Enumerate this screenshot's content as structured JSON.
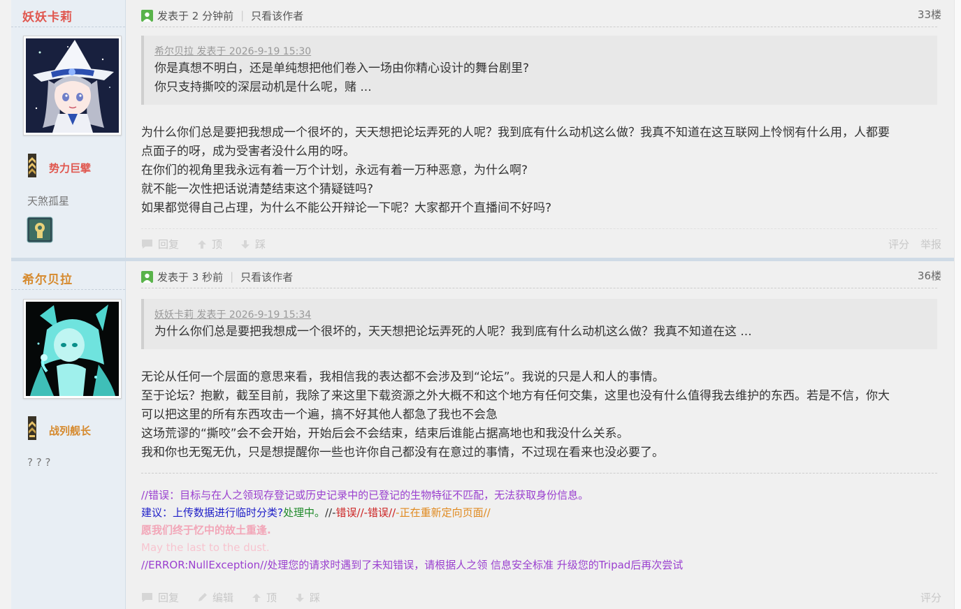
{
  "posts": [
    {
      "author": "妖妖卡莉",
      "author_color": "#e0564e",
      "rank": "势力巨擘",
      "rank_color": "#e0564e",
      "user_title": "天煞孤星",
      "posted": "发表于 2 分钟前",
      "only_author": "只看该作者",
      "floor": "33楼",
      "quote": {
        "head": "希尔贝拉 发表于 2026-9-19 15:30",
        "lines": [
          "你是真想不明白，还是单纯想把他们卷入一场由你精心设计的舞台剧里?",
          "你只支持撕咬的深层动机是什么呢，赌 ..."
        ]
      },
      "body": [
        "为什么你们总是要把我想成一个很坏的，天天想把论坛弄死的人呢？我到底有什么动机这么做？我真不知道在这互联网上怜悯有什么用，人都要",
        "点面子的呀，成为受害者没什么用的呀。",
        "在你们的视角里我永远有着一万个计划，永远有着一万种恶意，为什么啊?",
        "就不能一次性把话说清楚结束这个猜疑链吗?",
        "如果都觉得自己占理，为什么不能公开辩论一下呢？大家都开个直播间不好吗?"
      ],
      "actions": {
        "reply": "回复",
        "top": "顶",
        "down": "踩"
      },
      "actions_right": [
        "评分",
        "举报"
      ]
    },
    {
      "author": "希尔贝拉",
      "author_color": "#d68a2e",
      "rank": "战列舰长",
      "rank_color": "#d68a2e",
      "user_title": "? ? ?",
      "posted": "发表于 3 秒前",
      "only_author": "只看该作者",
      "floor": "36楼",
      "quote": {
        "head": "妖妖卡莉 发表于 2026-9-19 15:34",
        "lines": [
          "为什么你们总是要把我想成一个很坏的，天天想把论坛弄死的人呢？我到底有什么动机这么做？我真不知道在这 ..."
        ]
      },
      "body": [
        "无论从任何一个层面的意思来看，我相信我的表达都不会涉及到“论坛”。我说的只是人和人的事情。",
        "至于论坛？抱歉，截至目前，我除了来这里下载资源之外大概不和这个地方有任何交集，这里也没有什么值得我去维护的东西。若是不信，你大",
        "可以把这里的所有东西攻击一个遍，搞不好其他人都急了我也不会急",
        "这场荒谬的“撕咬”会不会开始，开始后会不会结束，结束后谁能占据高地也和我没什么关系。",
        "我和你也无冤无仇，只是想提醒你一些也许你自己都没有在意过的事情，不过现在看来也没必要了。"
      ],
      "signature": {
        "line1": "//错误：目标与在人之领现存登记或历史记录中的已登记的生物特征不匹配，无法获取身份信息。",
        "line2_a": "建议：上传数据进行临时分类?",
        "line2_b": "处理中。",
        "line2_c": "//-",
        "line2_d": "错误//-",
        "line2_e": "错误//",
        "line2_f": "-正在重新定向页面//",
        "line3": "愿我们终于忆中的故土重逢.",
        "line4": "May the last to the dust.",
        "line5": "//ERROR:NullException//处理您的请求时遇到了未知错误，请根据人之领 信息安全标准 升级您的Tripad后再次尝试",
        "colors": {
          "purple": "#9a3fcf",
          "blue": "#2020c8",
          "green": "#1f8a2a",
          "red": "#cc2222",
          "orange": "#e08a20",
          "pink": "#f2a6b8",
          "lightpink": "#f7c4cf"
        }
      },
      "actions": {
        "reply": "回复",
        "edit": "编辑",
        "top": "顶",
        "down": "踩"
      },
      "actions_right": [
        "评分"
      ]
    }
  ]
}
